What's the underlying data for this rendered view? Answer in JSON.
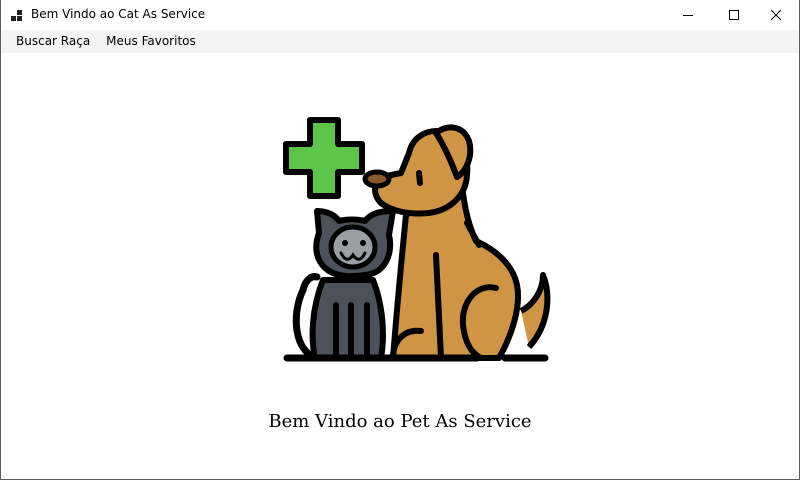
{
  "window": {
    "title": "Bem Vindo ao Cat As Service",
    "app_icon": "app-window-icon",
    "controls": [
      "minimize-icon",
      "maximize-icon",
      "close-icon"
    ]
  },
  "menu": {
    "items": [
      {
        "label": "Buscar Raça"
      },
      {
        "label": "Meus Favoritos"
      }
    ]
  },
  "main": {
    "hero_image": "pet-cat-dog-health-illustration",
    "welcome_text": "Bem Vindo ao Pet As Service"
  },
  "colors": {
    "cross": "#5cc54a",
    "dog": "#cf9444",
    "cat": "#4d5159",
    "cat_face": "#9b9ea4",
    "outline": "#000000",
    "menubar": "#f4f4f4"
  }
}
